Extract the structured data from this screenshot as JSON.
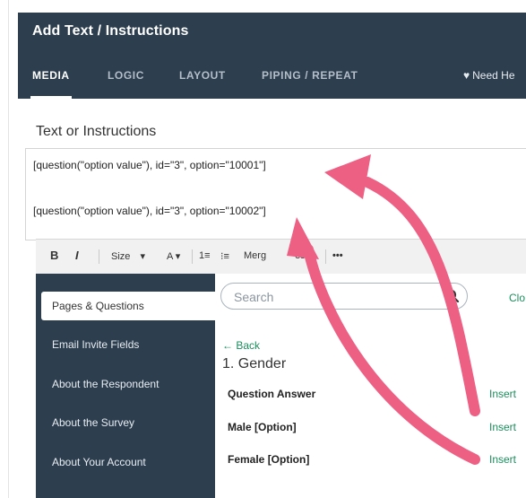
{
  "header": {
    "title": "Add Text / Instructions",
    "tabs": [
      {
        "label": "MEDIA",
        "active": true
      },
      {
        "label": "LOGIC",
        "active": false
      },
      {
        "label": "LAYOUT",
        "active": false
      },
      {
        "label": "PIPING / REPEAT",
        "active": false
      }
    ],
    "help_label": "Need He",
    "help_icon": "heart-icon"
  },
  "field_label": "Text or Instructions",
  "editor": {
    "lines": [
      "[question(\"option value\"), id=\"3\", option=\"10001\"]",
      "[question(\"option value\"), id=\"3\", option=\"10002\"]"
    ]
  },
  "toolbar": {
    "bold": "B",
    "italic": "I",
    "size": "Size",
    "size_caret": "▾",
    "text_color": "A",
    "color_caret": "▾",
    "ordered_list": "1≡",
    "unordered_list": "⁝≡",
    "merge_codes": "Merg",
    "merge_codes_tail": "es",
    "more": "•••"
  },
  "sidebar": {
    "items": [
      {
        "label": "Pages & Questions",
        "active": true
      },
      {
        "label": "Email Invite Fields",
        "active": false
      },
      {
        "label": "About the Respondent",
        "active": false
      },
      {
        "label": "About the Survey",
        "active": false
      },
      {
        "label": "About Your Account",
        "active": false
      }
    ]
  },
  "panel": {
    "search_placeholder": "Search",
    "close_label": "Clo",
    "back_label": "← Back",
    "question_title": "1. Gender",
    "rows": [
      {
        "label": "Question Answer",
        "action": "Insert"
      },
      {
        "label": "Male [Option]",
        "action": "Insert"
      },
      {
        "label": "Female [Option]",
        "action": "Insert"
      }
    ]
  },
  "colors": {
    "header_bg": "#2d3e4f",
    "sidebar_bg": "#2d3e4f",
    "link_green": "#1a8f5d",
    "annotation_arrow": "#ee5f84"
  }
}
